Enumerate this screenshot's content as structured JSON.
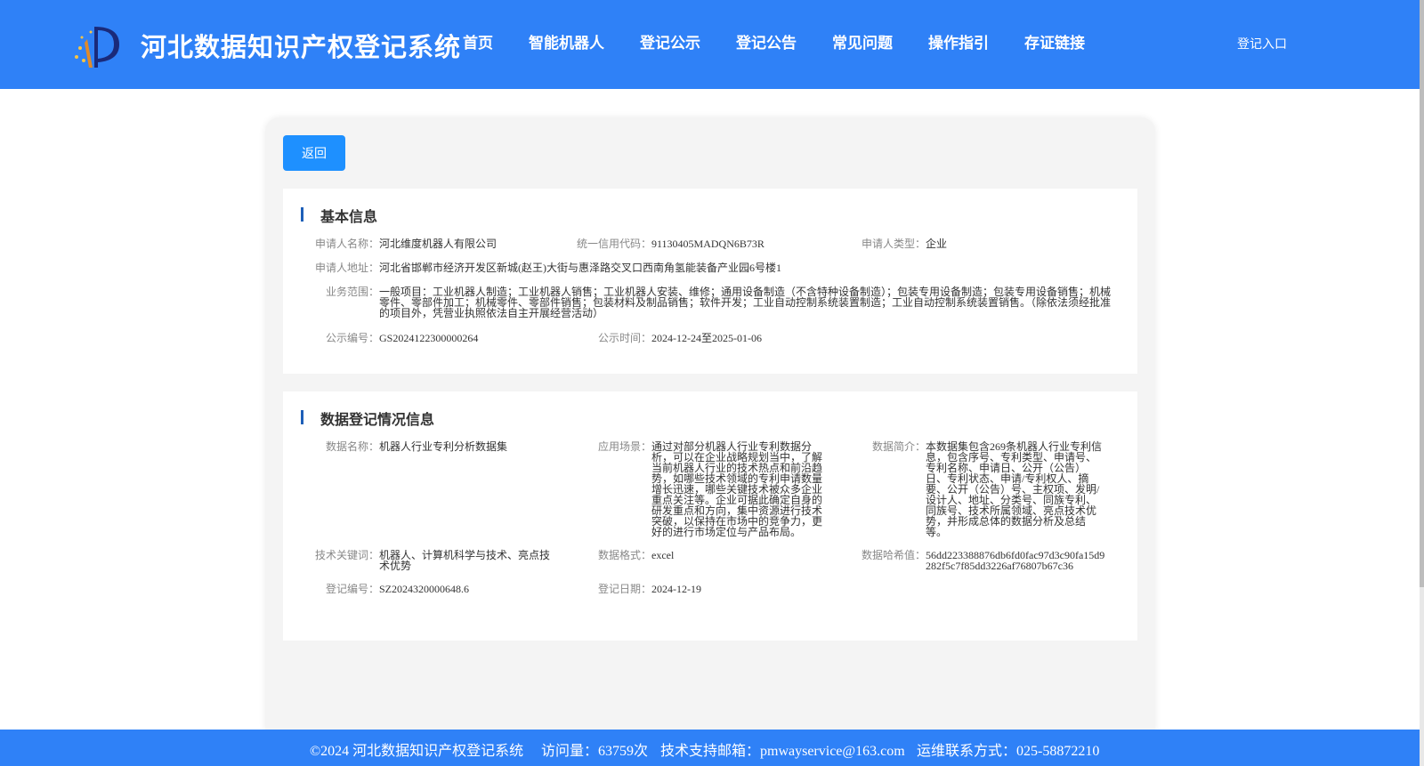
{
  "header": {
    "site_title": "河北数据知识产权登记系统",
    "nav": [
      "首页",
      "智能机器人",
      "登记公示",
      "登记公告",
      "常见问题",
      "操作指引",
      "存证链接"
    ],
    "login": "登记入口"
  },
  "main": {
    "back_label": "返回",
    "basic": {
      "title": "基本信息",
      "applicant_name_label": "申请人名称：",
      "applicant_name": "河北维度机器人有限公司",
      "credit_code_label": "统一信用代码：",
      "credit_code": "91130405MADQN6B73R",
      "applicant_type_label": "申请人类型：",
      "applicant_type": "企业",
      "address_label": "申请人地址：",
      "address": "河北省邯郸市经济开发区新城(赵王)大街与惠泽路交叉口西南角氢能装备产业园6号楼1",
      "scope_label": "业务范围：",
      "scope": "一般项目：工业机器人制造；工业机器人销售；工业机器人安装、维修；通用设备制造（不含特种设备制造）；包装专用设备制造；包装专用设备销售；机械零件、零部件加工；机械零件、零部件销售；包装材料及制品销售；软件开发；工业自动控制系统装置制造；工业自动控制系统装置销售。（除依法须经批准的项目外，凭营业执照依法自主开展经营活动）",
      "notice_no_label": "公示编号：",
      "notice_no": "GS2024122300000264",
      "notice_time_label": "公示时间：",
      "notice_time": "2024-12-24至2025-01-06"
    },
    "data": {
      "title": "数据登记情况信息",
      "name_label": "数据名称：",
      "name": "机器人行业专利分析数据集",
      "scenario_label": "应用场景：",
      "scenario": "通过对部分机器人行业专利数据分析，可以在企业战略规划当中，了解当前机器人行业的技术热点和前沿趋势，如哪些技术领域的专利申请数量增长迅速，哪些关键技术被众多企业重点关注等。企业可据此确定自身的研发重点和方向，集中资源进行技术突破，以保持在市场中的竞争力，更好的进行市场定位与产品布局。",
      "intro_label": "数据简介：",
      "intro": "本数据集包含269条机器人行业专利信息，包含序号、专利类型、申请号、专利名称、申请日、公开（公告）日、专利状态、申请/专利权人、摘要、公开（公告）号、主权项、发明/设计人、地址、分类号、同族专利、同族号、技术所属领域、亮点技术优势，并形成总体的数据分析及总结等。",
      "keywords_label": "技术关键词：",
      "keywords": "机器人、计算机科学与技术、亮点技术优势",
      "format_label": "数据格式：",
      "format": "excel",
      "hash_label": "数据哈希值：",
      "hash": "56dd223388876db6fd0fac97d3c90fa15d9282f5c7f85dd3226af76807b67c36",
      "reg_no_label": "登记编号：",
      "reg_no": "SZ2024320000648.6",
      "reg_date_label": "登记日期：",
      "reg_date": "2024-12-19"
    }
  },
  "footer": {
    "copyright": "©2024 河北数据知识产权登记系统",
    "visits": "访问量：63759次",
    "email": "技术支持邮箱：pmwayservice@163.com",
    "phone": "运维联系方式：025-58872210"
  },
  "colors": {
    "header": "#2f81f7",
    "button": "#1e90ff",
    "title_bar": "#1e5fb8"
  }
}
